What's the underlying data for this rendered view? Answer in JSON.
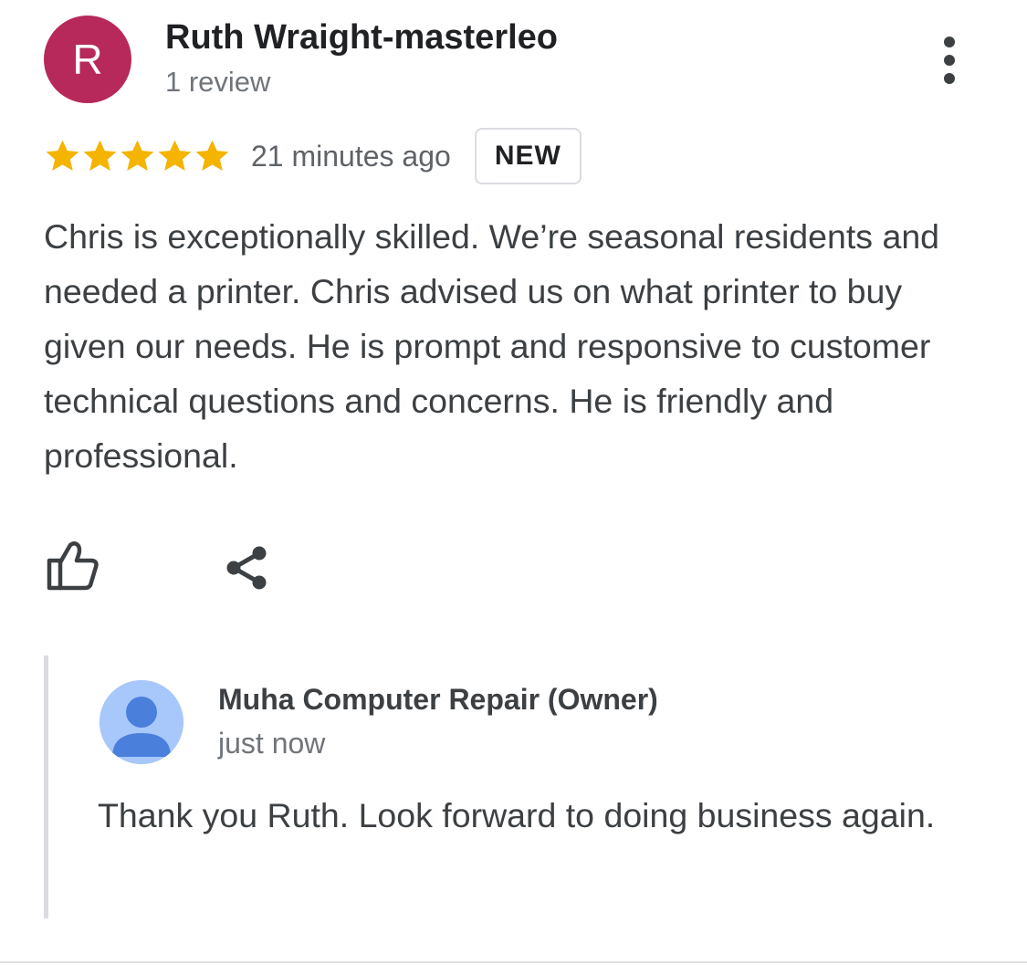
{
  "review": {
    "avatar_initial": "R",
    "avatar_color": "#b7295a",
    "reviewer_name": "Ruth Wraight-masterleo",
    "review_count": "1 review",
    "rating": 5,
    "rating_max": 5,
    "star_color": "#f4b400",
    "time": "21 minutes ago",
    "badge": "NEW",
    "text": "Chris is exceptionally skilled. We’re seasonal residents and needed a printer. Chris advised us on what printer to buy given our needs. He is prompt and responsive to customer technical questions and concerns. He is friendly and professional.",
    "more_icon": "more-vert-icon",
    "actions": {
      "like_icon": "thumbs-up-icon",
      "share_icon": "share-icon"
    }
  },
  "owner_reply": {
    "avatar_icon": "person-icon",
    "avatar_bg_color": "#a8c7fa",
    "avatar_fg_color": "#4a7fdc",
    "name": "Muha Computer Repair (Owner)",
    "time": "just now",
    "text": "Thank you Ruth. Look forward to doing business again."
  }
}
